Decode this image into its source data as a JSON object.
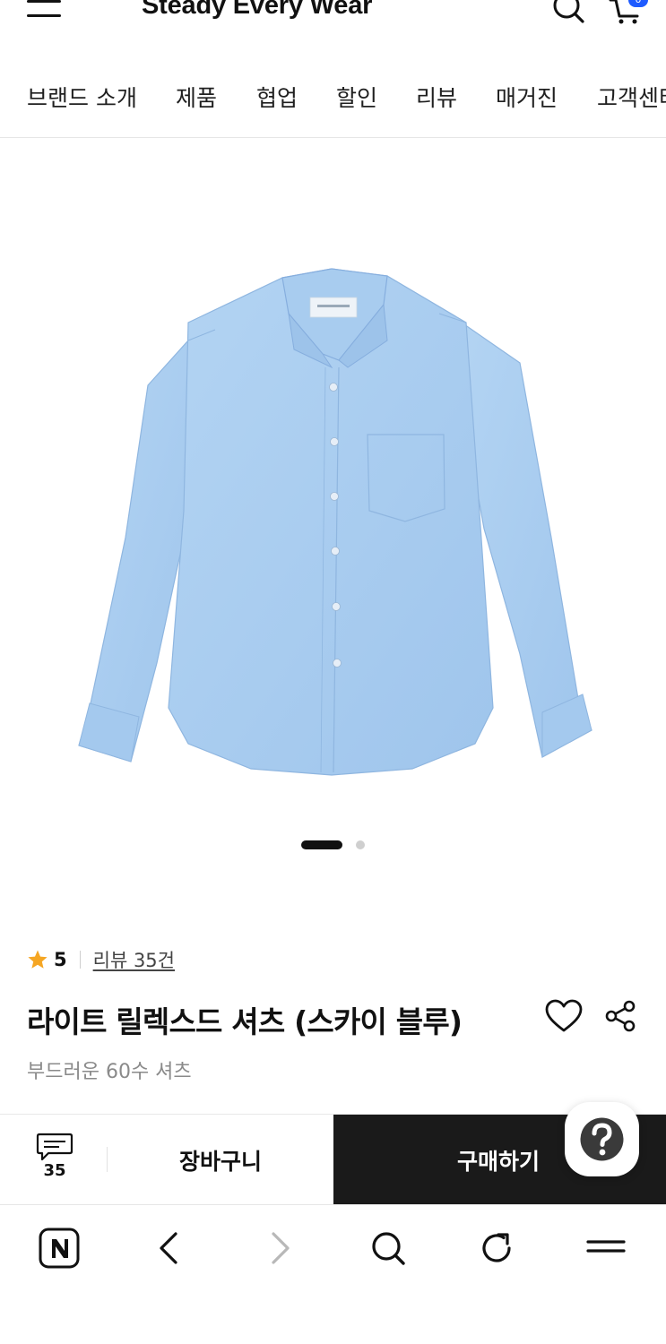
{
  "header": {
    "brand": "Steady Every Wear",
    "cart_count": "0"
  },
  "categories": [
    "브랜드 소개",
    "제품",
    "협업",
    "할인",
    "리뷰",
    "매거진",
    "고객센터"
  ],
  "product": {
    "rating": "5",
    "review_link": "리뷰 35건",
    "name": "라이트 릴렉스드 셔츠 (스카이 블루)",
    "subtitle": "부드러운 60수 셔츠",
    "image_count": 2,
    "current_image": 1
  },
  "buybar": {
    "review_count": "35",
    "cart_label": "장바구니",
    "buy_label": "구매하기"
  },
  "colors": {
    "accent": "#1e5bff",
    "star": "#f5a623",
    "buy_bg": "#1a1a1a",
    "shirt": "#a9cdf0"
  },
  "icons": {
    "menu": "hamburger-icon",
    "search": "search-icon",
    "cart": "cart-icon",
    "heart": "heart-icon",
    "share": "share-icon",
    "help": "question-icon",
    "review": "chat-icon",
    "browser_home": "naver-n-icon",
    "back": "chevron-left-icon",
    "forward": "chevron-right-icon",
    "browser_search": "search-icon",
    "refresh": "refresh-icon",
    "browser_menu": "menu-icon"
  }
}
